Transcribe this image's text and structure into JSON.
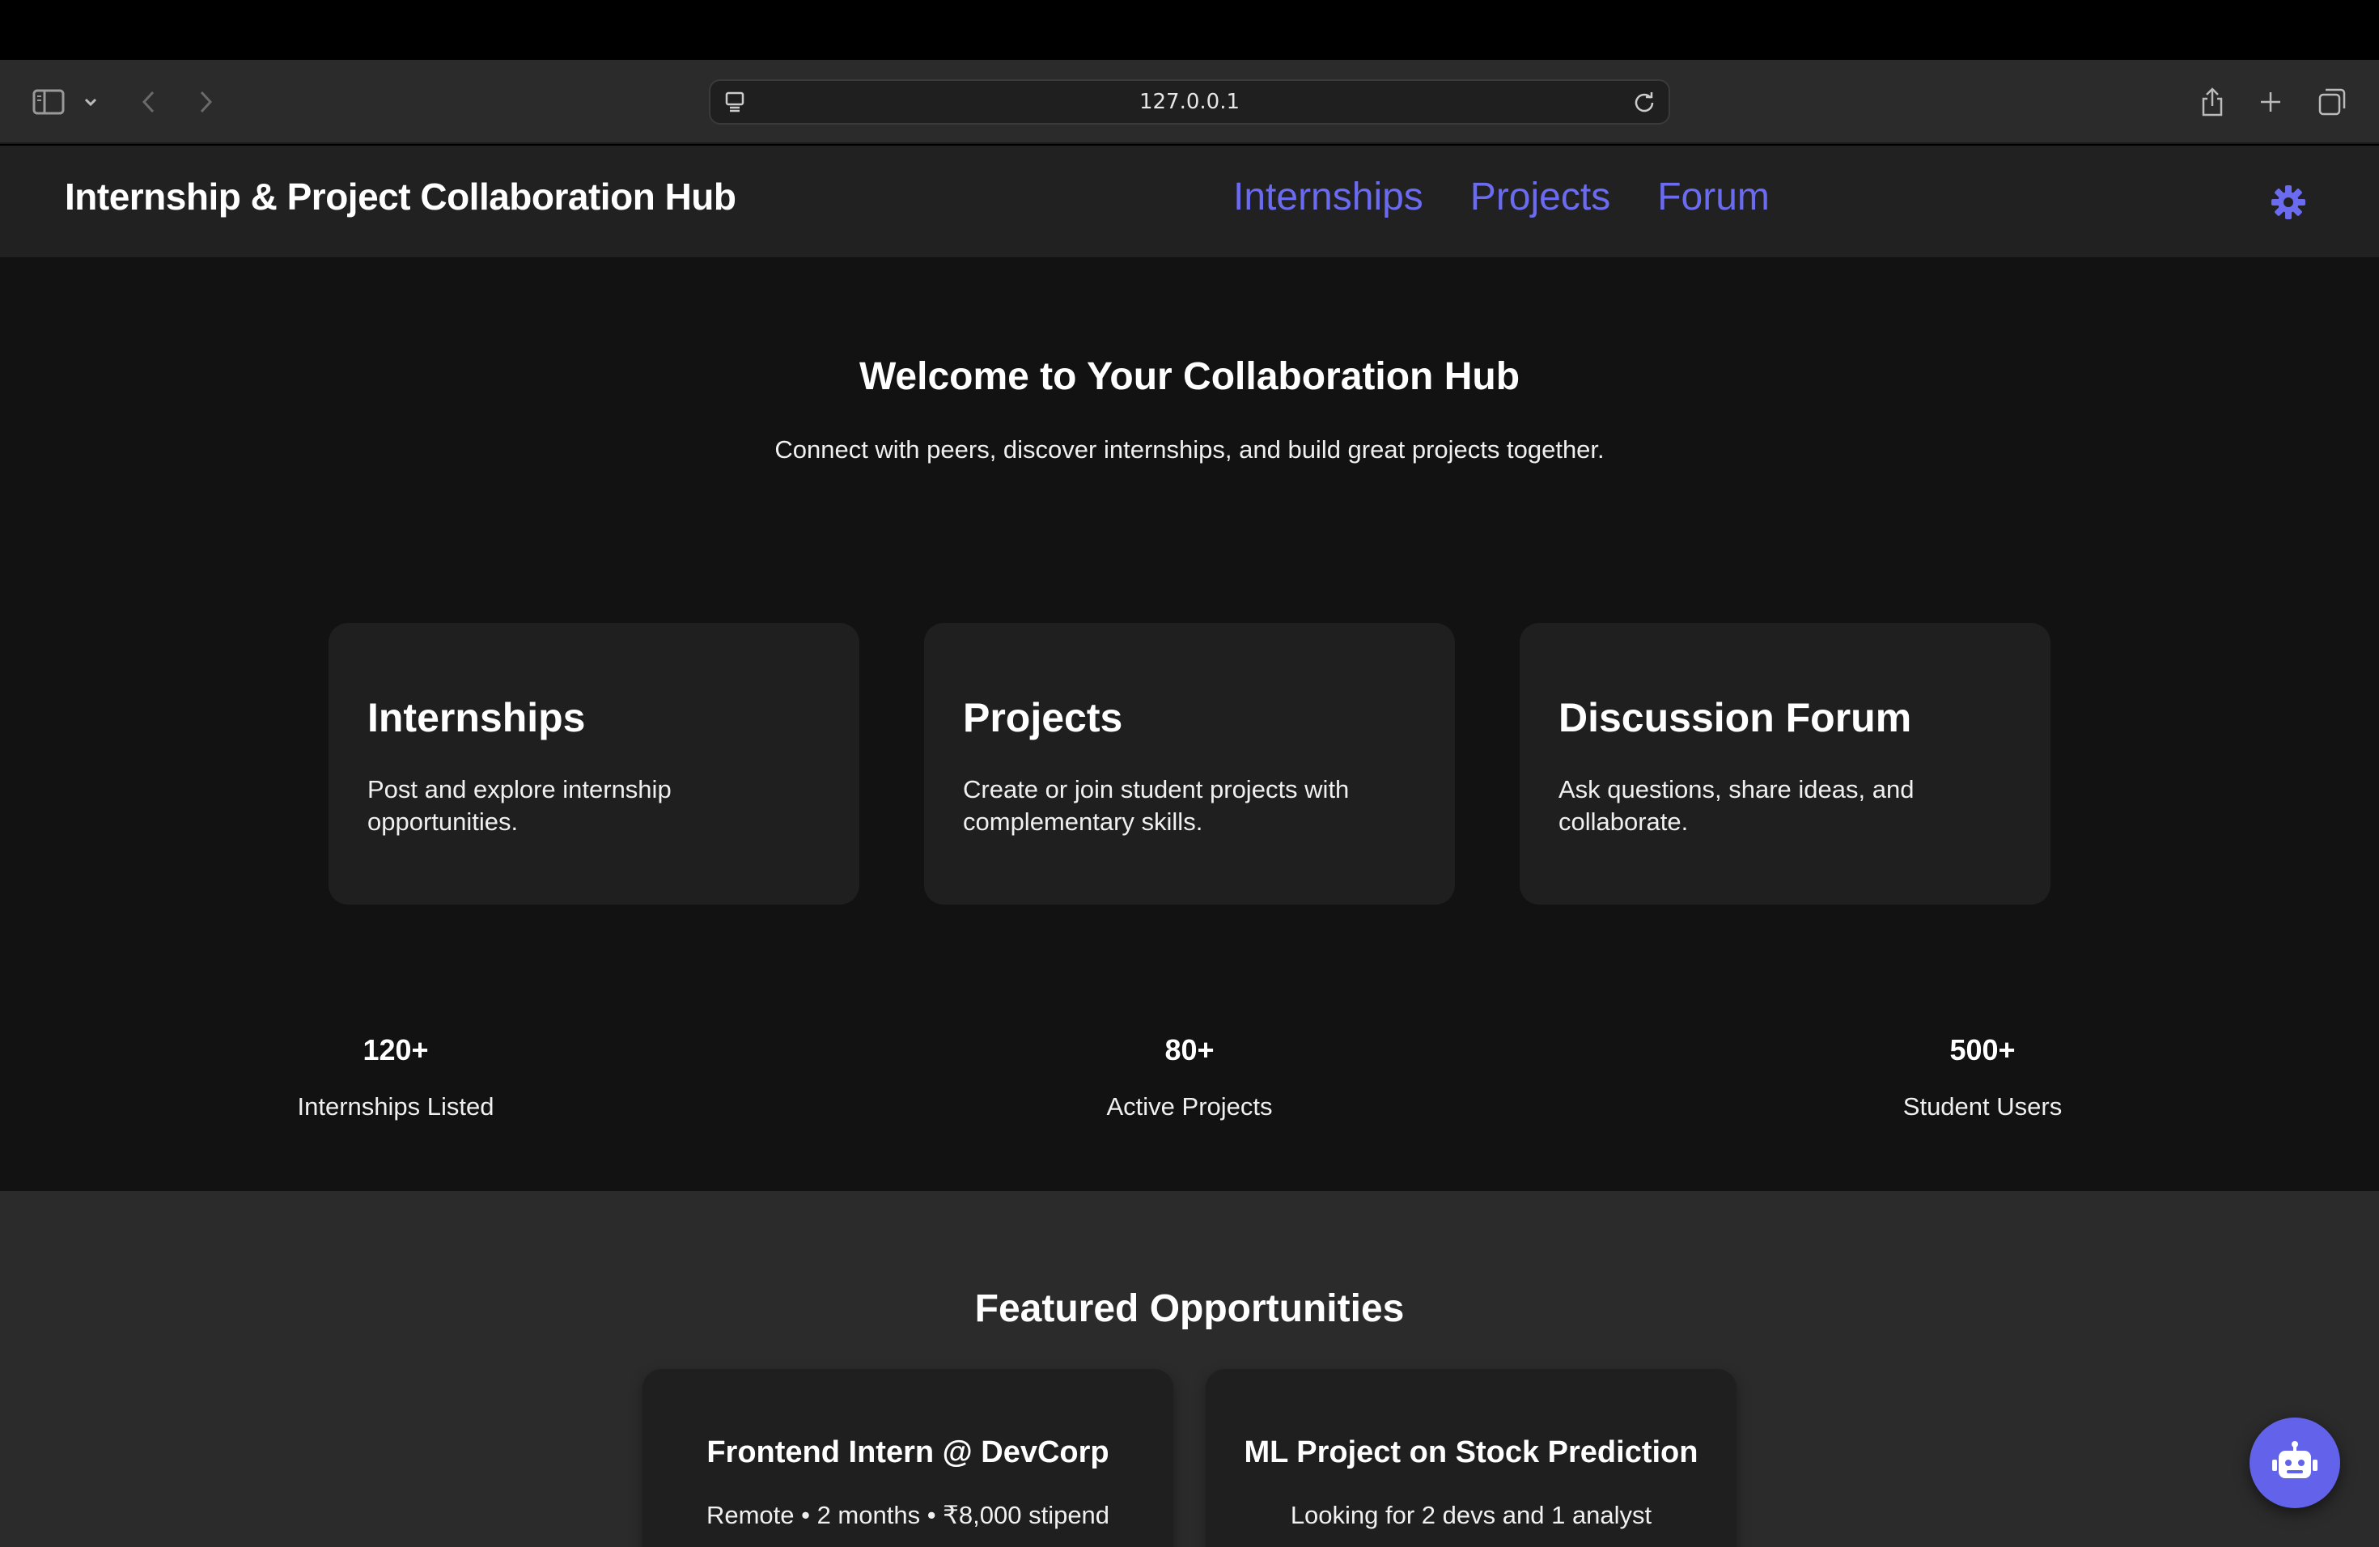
{
  "browser": {
    "address": "127.0.0.1"
  },
  "header": {
    "brand": "Internship & Project Collaboration Hub",
    "nav": [
      {
        "label": "Internships"
      },
      {
        "label": "Projects"
      },
      {
        "label": "Forum"
      }
    ],
    "theme_icon": "gear-icon"
  },
  "hero": {
    "title": "Welcome to Your Collaboration Hub",
    "subtitle": "Connect with peers, discover internships, and build great projects together."
  },
  "cards": [
    {
      "title": "Internships",
      "desc": "Post and explore internship opportunities."
    },
    {
      "title": "Projects",
      "desc": "Create or join student projects with complementary skills."
    },
    {
      "title": "Discussion Forum",
      "desc": "Ask questions, share ideas, and collaborate."
    }
  ],
  "stats": [
    {
      "num": "120+",
      "label": "Internships Listed"
    },
    {
      "num": "80+",
      "label": "Active Projects"
    },
    {
      "num": "500+",
      "label": "Student Users"
    }
  ],
  "featured": {
    "title": "Featured Opportunities",
    "items": [
      {
        "title": "Frontend Intern @ DevCorp",
        "meta": "Remote • 2 months • ₹8,000 stipend"
      },
      {
        "title": "ML Project on Stock Prediction",
        "meta": "Looking for 2 devs and 1 analyst"
      }
    ]
  },
  "colors": {
    "accent": "#6b6bf0",
    "fab": "#6262ea"
  }
}
